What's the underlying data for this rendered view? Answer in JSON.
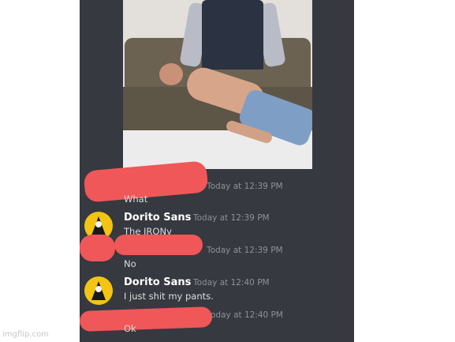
{
  "chat": {
    "messages": [
      {
        "username": "",
        "timestamp": "Today at 12:39 PM",
        "text": "What"
      },
      {
        "username": "Dorito Sans",
        "timestamp": "Today at 12:39 PM",
        "text": "The IRONy"
      },
      {
        "username": "",
        "timestamp": "Today at 12:39 PM",
        "text": "No"
      },
      {
        "username": "Dorito Sans",
        "timestamp": "Today at 12:40 PM",
        "text": "I just shit my pants."
      },
      {
        "username": "",
        "timestamp": "oday at 12:40 PM",
        "text": "Ok"
      }
    ]
  },
  "watermark": "imgflip.com",
  "colors": {
    "chat_background": "#36393f",
    "username": "#ffffff",
    "timestamp": "#8e9297",
    "message_text": "#dcddde",
    "redaction": "#ef5759",
    "avatar": "#f2c414"
  },
  "icons": {
    "attached_image": "photo",
    "avatar": "dorito-avatar-icon"
  }
}
